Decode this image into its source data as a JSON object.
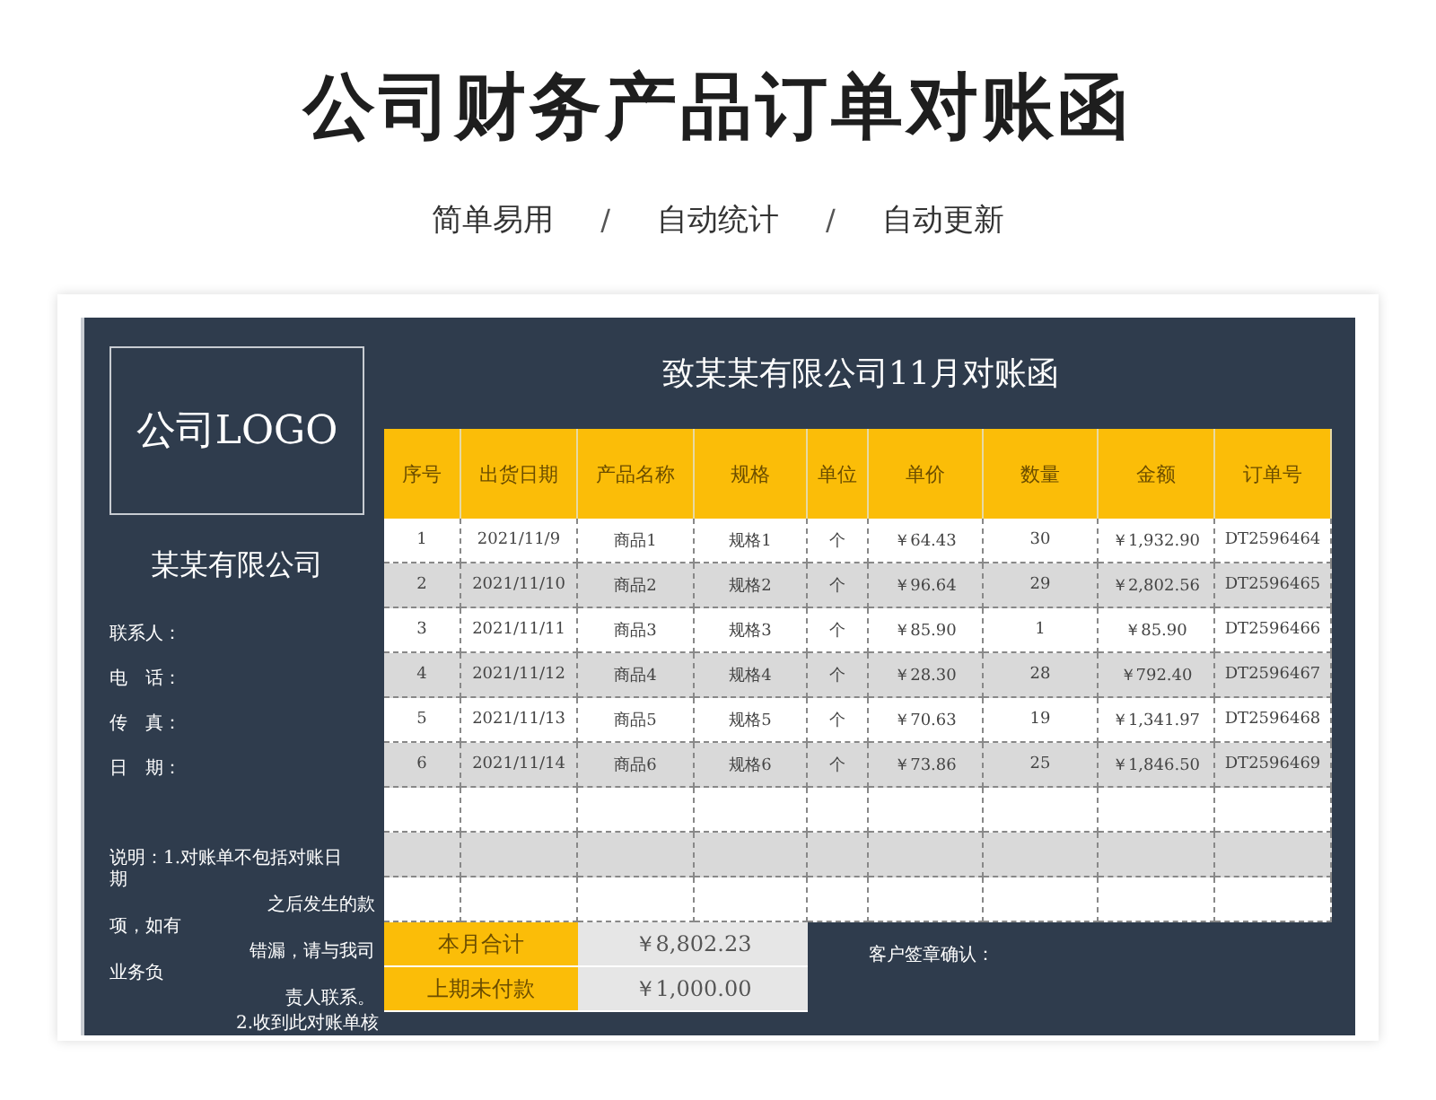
{
  "page": {
    "title": "公司财务产品订单对账函",
    "tags": [
      "简单易用",
      "自动统计",
      "自动更新"
    ],
    "separator": "/"
  },
  "sheet": {
    "logo": "公司LOGO",
    "company": "某某有限公司",
    "contacts": [
      "联系人：",
      "电　话：",
      "传　真：",
      "日　期："
    ],
    "notes": [
      {
        "text": "说明：1.对账单不包括对账日",
        "kind": "left"
      },
      {
        "text": "期",
        "kind": "left"
      },
      {
        "text": "之后发生的款",
        "kind": "indent"
      },
      {
        "text": "项，如有",
        "kind": "left"
      },
      {
        "text": "错漏，请与我司",
        "kind": "indent"
      },
      {
        "text": "业务负",
        "kind": "left"
      },
      {
        "text": "责人联系。",
        "kind": "indent"
      },
      {
        "text": "2.收到此对账单核",
        "kind": "right"
      }
    ],
    "heading": "致某某有限公司11月对账函",
    "table": {
      "columns": [
        "序号",
        "出货日期",
        "产品名称",
        "规格",
        "单位",
        "单价",
        "数量",
        "金额",
        "订单号"
      ],
      "rows": [
        [
          "1",
          "2021/11/9",
          "商品1",
          "规格1",
          "个",
          "￥64.43",
          "30",
          "￥1,932.90",
          "DT2596464"
        ],
        [
          "2",
          "2021/11/10",
          "商品2",
          "规格2",
          "个",
          "￥96.64",
          "29",
          "￥2,802.56",
          "DT2596465"
        ],
        [
          "3",
          "2021/11/11",
          "商品3",
          "规格3",
          "个",
          "￥85.90",
          "1",
          "￥85.90",
          "DT2596466"
        ],
        [
          "4",
          "2021/11/12",
          "商品4",
          "规格4",
          "个",
          "￥28.30",
          "28",
          "￥792.40",
          "DT2596467"
        ],
        [
          "5",
          "2021/11/13",
          "商品5",
          "规格5",
          "个",
          "￥70.63",
          "19",
          "￥1,341.97",
          "DT2596468"
        ],
        [
          "6",
          "2021/11/14",
          "商品6",
          "规格6",
          "个",
          "￥73.86",
          "25",
          "￥1,846.50",
          "DT2596469"
        ],
        [],
        [],
        []
      ]
    },
    "summary": [
      {
        "label": "本月合计",
        "value": "￥8,802.23"
      },
      {
        "label": "上期未付款",
        "value": "￥1,000.00"
      }
    ],
    "signature": "客户签章确认："
  }
}
